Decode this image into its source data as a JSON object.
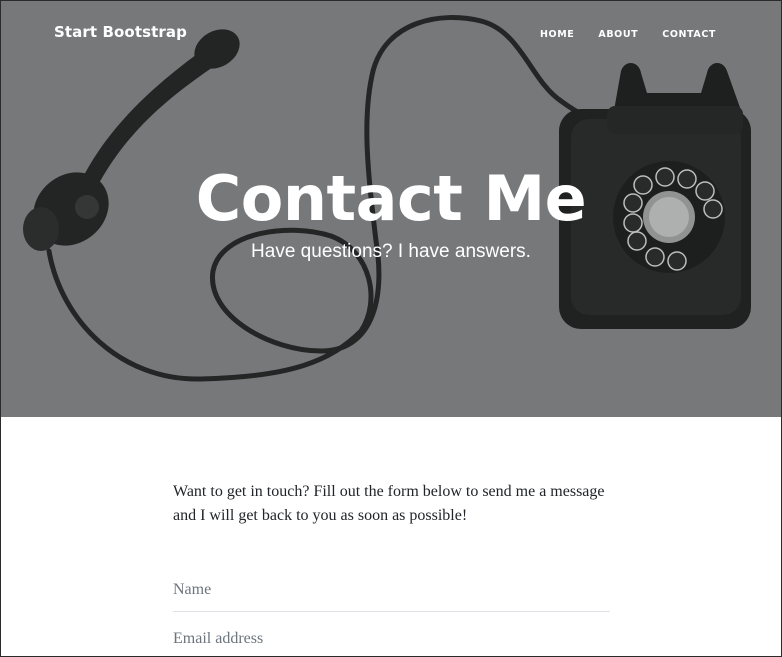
{
  "navbar": {
    "brand": "Start Bootstrap",
    "items": [
      {
        "label": "Home"
      },
      {
        "label": "About"
      },
      {
        "label": "Contact"
      }
    ]
  },
  "hero": {
    "title": "Contact Me",
    "subtitle": "Have questions? I have answers.",
    "background_icon": "rotary-telephone-image",
    "overlay_color": "#7a7b7d"
  },
  "main": {
    "intro": "Want to get in touch? Fill out the form below to send me a message and I will get back to you as soon as possible!",
    "form": {
      "name_placeholder": "Name",
      "email_placeholder": "Email address"
    }
  }
}
